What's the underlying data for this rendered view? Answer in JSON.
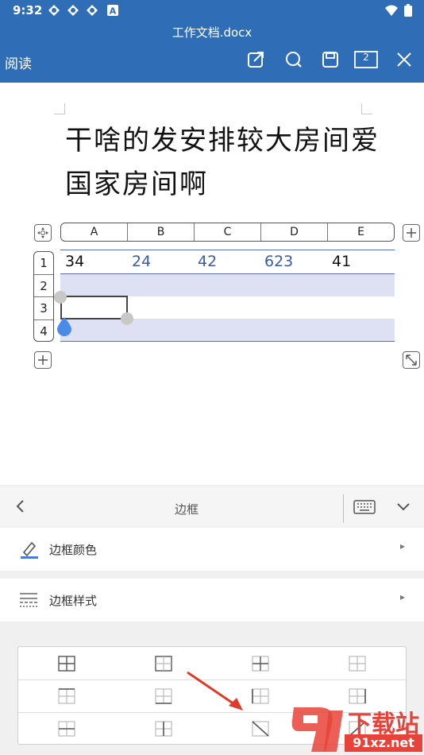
{
  "status_bar": {
    "time": "9:32",
    "notification_icons": [
      "app-icon",
      "app-icon",
      "app-icon",
      "a-icon"
    ],
    "battery": "battery-icon",
    "wifi": "wifi-icon"
  },
  "header": {
    "filename": "工作文档.docx",
    "mode_label": "阅读",
    "page_count": "2",
    "actions": [
      "share-icon",
      "search-icon",
      "save-icon",
      "page-count-icon",
      "close-icon"
    ]
  },
  "document": {
    "title": "干啥的发安排较大房间爱国家房间啊",
    "table": {
      "columns": [
        "A",
        "B",
        "C",
        "D",
        "E"
      ],
      "rows": [
        "1",
        "2",
        "3",
        "4"
      ],
      "row1_values": [
        "34",
        "24",
        "42",
        "623",
        "41"
      ]
    }
  },
  "panel": {
    "title": "边框",
    "options": [
      {
        "label": "边框颜色",
        "icon": "pen-icon"
      },
      {
        "label": "边框样式",
        "icon": "line-style-icon"
      }
    ],
    "border_grid_rows": 3,
    "border_grid_cols": 4
  },
  "watermark": {
    "text_cn": "下载站",
    "text_url": "91xz.net"
  },
  "colors": {
    "header_bg": "#2f6db7",
    "row_highlight": "#dde1f3",
    "table_line": "#5c6ab8",
    "numbers_blue": "#3b5aa8",
    "handle_blue": "#4b8be8"
  }
}
